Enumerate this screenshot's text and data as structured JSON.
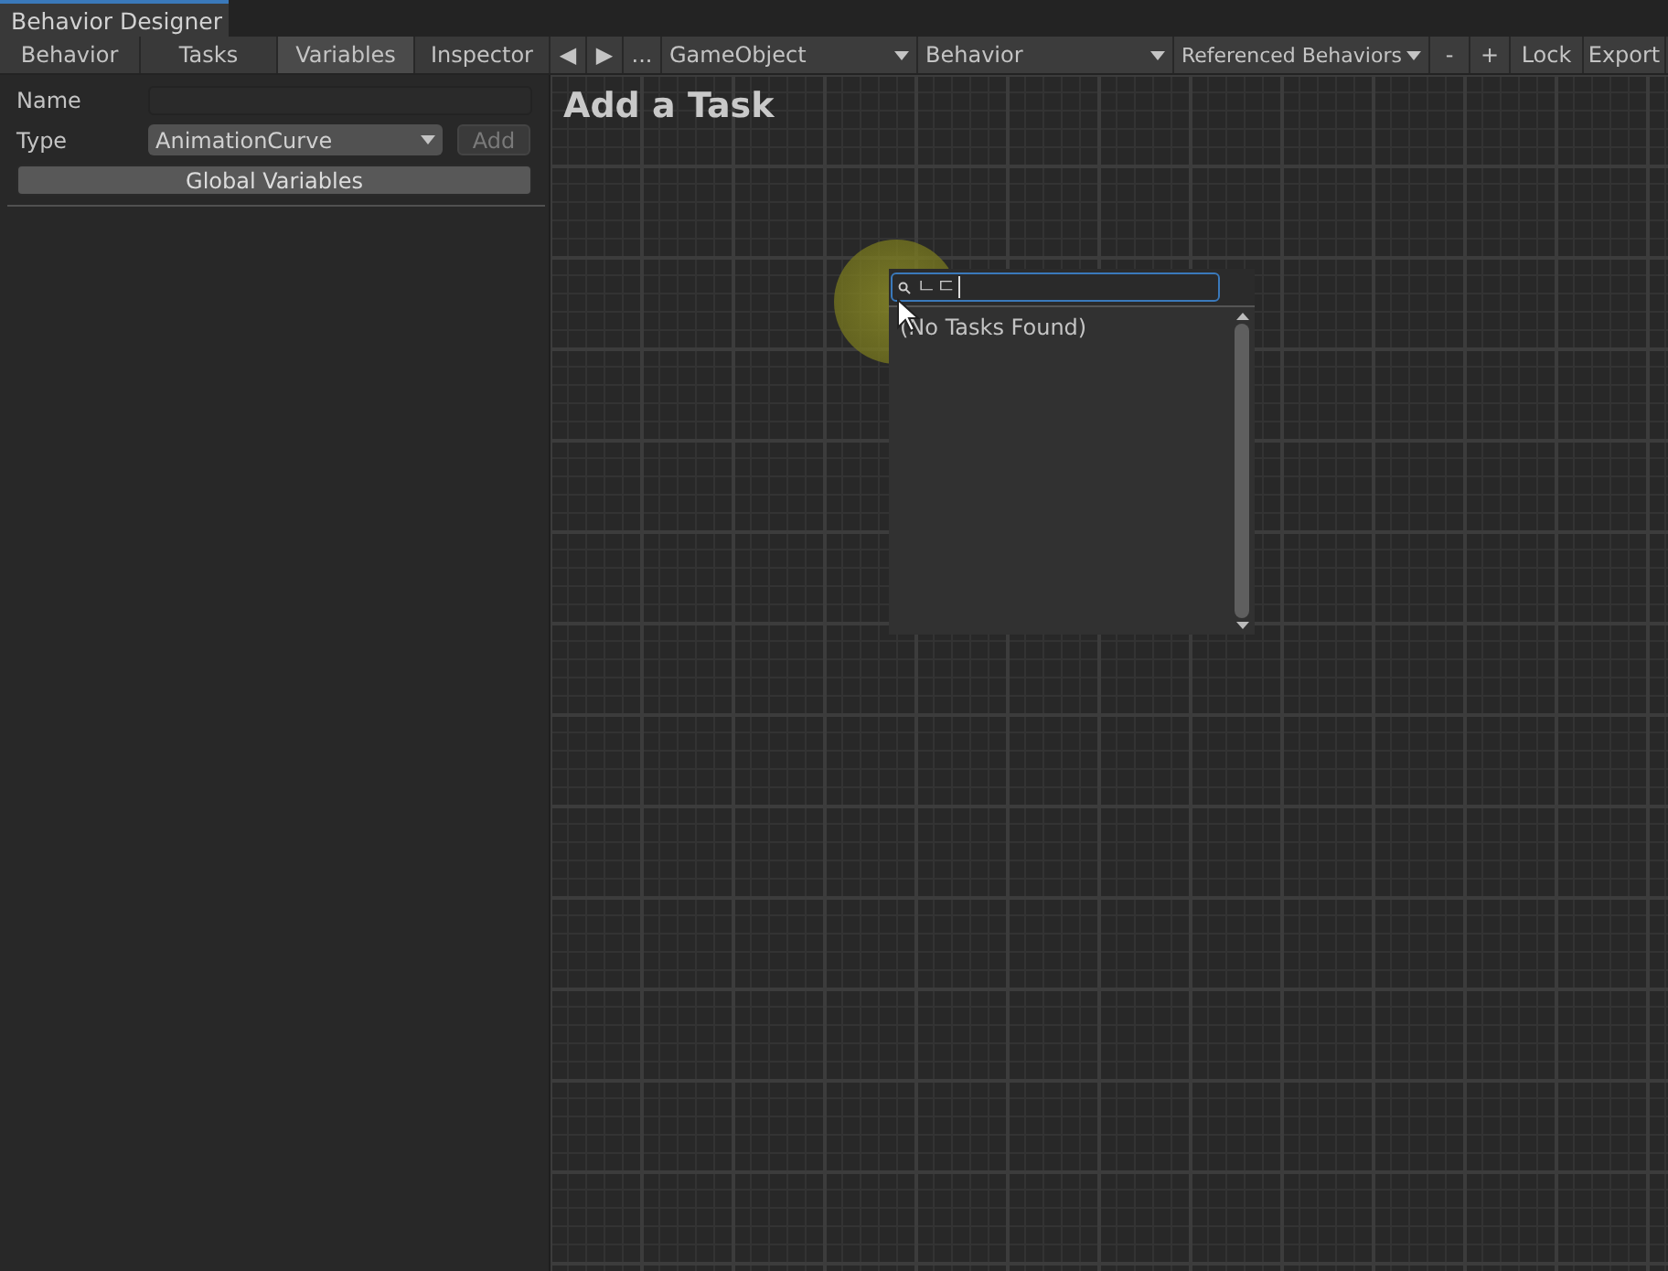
{
  "window": {
    "title": "Behavior Designer"
  },
  "tabs": [
    {
      "label": "Behavior",
      "selected": false
    },
    {
      "label": "Tasks",
      "selected": false
    },
    {
      "label": "Variables",
      "selected": true
    },
    {
      "label": "Inspector",
      "selected": false
    }
  ],
  "toolbar": {
    "back": "◀",
    "forward": "▶",
    "more": "...",
    "dropdowns": [
      {
        "label": "GameObject"
      },
      {
        "label": "Behavior"
      },
      {
        "label": "Referenced Behaviors"
      }
    ],
    "buttons": [
      "-",
      "+",
      "Lock",
      "Export"
    ]
  },
  "variables": {
    "name_label": "Name",
    "type_label": "Type",
    "type_value": "AnimationCurve",
    "add_button": {
      "label": "Add",
      "disabled": true
    },
    "global_button": "Global Variables"
  },
  "canvas": {
    "title": "Add a Task"
  },
  "task_popup": {
    "search_value": "ㄴㄷ",
    "empty_text": "(No Tasks Found)"
  }
}
